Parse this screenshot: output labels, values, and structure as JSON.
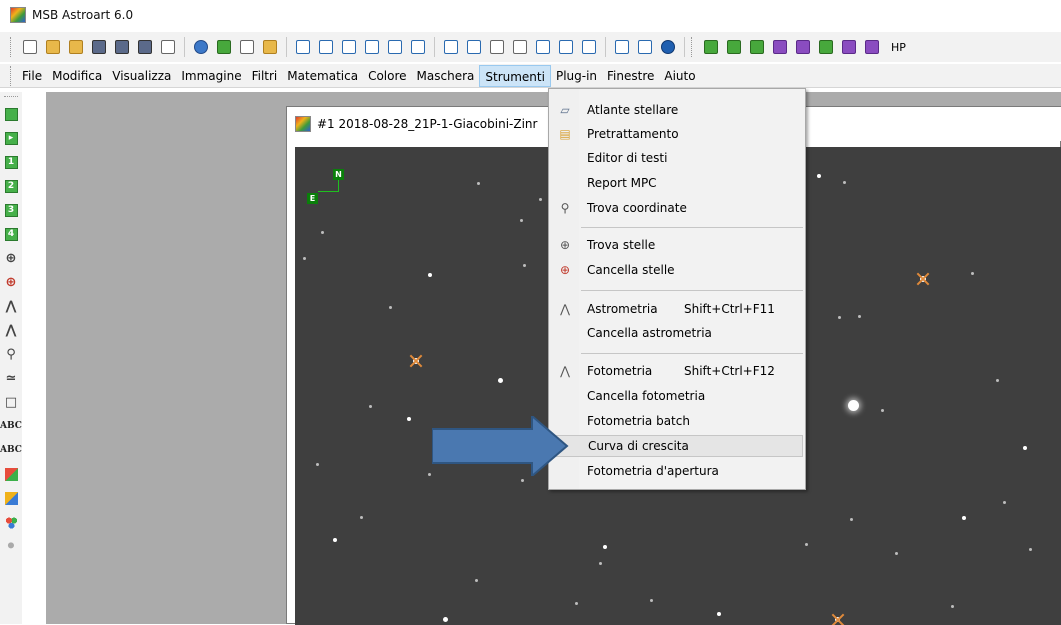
{
  "window": {
    "title": "MSB Astroart 6.0"
  },
  "toolbar": {
    "right_label": "HP"
  },
  "menubar": {
    "items": [
      {
        "label": "File"
      },
      {
        "label": "Modifica"
      },
      {
        "label": "Visualizza"
      },
      {
        "label": "Immagine"
      },
      {
        "label": "Filtri"
      },
      {
        "label": "Matematica"
      },
      {
        "label": "Colore"
      },
      {
        "label": "Maschera"
      },
      {
        "label": "Strumenti",
        "active": true
      },
      {
        "label": "Plug-in"
      },
      {
        "label": "Finestre"
      },
      {
        "label": "Aiuto"
      }
    ]
  },
  "left_toolbar": {
    "numbered_buttons": [
      "1",
      "2",
      "3",
      "4"
    ],
    "text_tools": [
      "ABC",
      "ABC"
    ]
  },
  "document": {
    "title": "#1 2018-08-28_21P-1-Giacobini-Zinr",
    "compass": {
      "north": "N",
      "east": "E"
    }
  },
  "strumenti_menu": {
    "items": [
      {
        "label": "Atlante stellare",
        "icon": "atlas-icon"
      },
      {
        "label": "Pretrattamento",
        "icon": "folder-icon"
      },
      {
        "label": "Editor di testi",
        "icon": ""
      },
      {
        "label": "Report MPC",
        "icon": ""
      },
      {
        "label": "Trova coordinate",
        "icon": "magnifier-question-icon"
      },
      {
        "label": "Trova stelle",
        "icon": "find-stars-icon"
      },
      {
        "label": "Cancella stelle",
        "icon": "delete-stars-icon"
      },
      {
        "label": "Astrometria",
        "shortcut": "Shift+Ctrl+F11",
        "icon": "astrometry-icon"
      },
      {
        "label": "Cancella astrometria",
        "icon": ""
      },
      {
        "label": "Fotometria",
        "shortcut": "Shift+Ctrl+F12",
        "icon": "photometry-icon"
      },
      {
        "label": "Cancella fotometria",
        "icon": ""
      },
      {
        "label": "Fotometria batch",
        "icon": ""
      },
      {
        "label": "Curva di crescita",
        "icon": "",
        "hover": true
      },
      {
        "label": "Fotometria d'apertura",
        "icon": ""
      }
    ]
  },
  "colors": {
    "menu_highlight": "#cce4f7",
    "arrow_fill": "#4a78b0",
    "compass_green": "#1fbf1f",
    "image_background": "#3f3f3f"
  }
}
